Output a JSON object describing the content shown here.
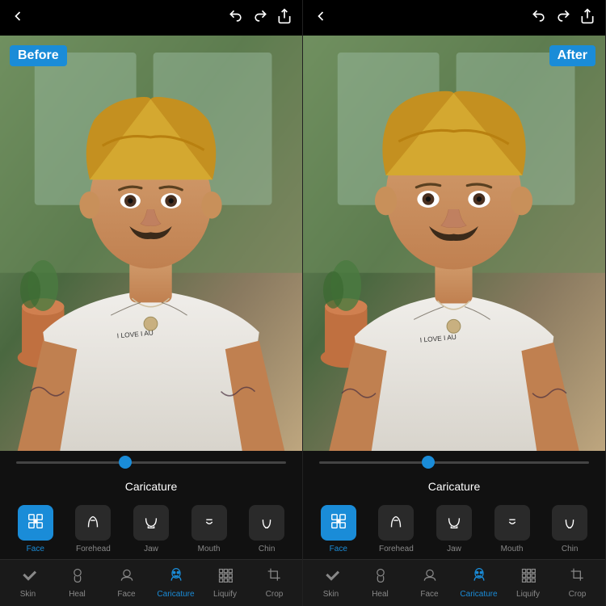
{
  "panels": [
    {
      "id": "before",
      "badge": "Before",
      "badgeType": "before",
      "sliderPosition": "40%",
      "sectionLabel": "Caricature",
      "tools": [
        {
          "id": "face",
          "label": "Face",
          "active": true,
          "icon": "face-grid"
        },
        {
          "id": "forehead",
          "label": "Forehead",
          "active": false,
          "icon": "forehead"
        },
        {
          "id": "jaw",
          "label": "Jaw",
          "active": false,
          "icon": "jaw"
        },
        {
          "id": "mouth",
          "label": "Mouth",
          "active": false,
          "icon": "mouth"
        },
        {
          "id": "chin",
          "label": "Chin",
          "active": false,
          "icon": "chin"
        }
      ],
      "bottomTools": [
        {
          "id": "skin",
          "label": "Skin",
          "active": false,
          "icon": "pencil"
        },
        {
          "id": "heal",
          "label": "Heal",
          "active": false,
          "icon": "person-heal"
        },
        {
          "id": "face-tool",
          "label": "Face",
          "active": false,
          "icon": "face-person"
        },
        {
          "id": "caricature",
          "label": "Caricature",
          "active": true,
          "icon": "caricature-person"
        },
        {
          "id": "liquify",
          "label": "Liquify",
          "active": false,
          "icon": "grid-dots"
        },
        {
          "id": "crop",
          "label": "Crop",
          "active": false,
          "icon": "crop"
        }
      ]
    },
    {
      "id": "after",
      "badge": "After",
      "badgeType": "after",
      "sliderPosition": "40%",
      "sectionLabel": "Caricature",
      "tools": [
        {
          "id": "face",
          "label": "Face",
          "active": true,
          "icon": "face-grid"
        },
        {
          "id": "forehead",
          "label": "Forehead",
          "active": false,
          "icon": "forehead"
        },
        {
          "id": "jaw",
          "label": "Jaw",
          "active": false,
          "icon": "jaw"
        },
        {
          "id": "mouth",
          "label": "Mouth",
          "active": false,
          "icon": "mouth"
        },
        {
          "id": "chin",
          "label": "Chin",
          "active": false,
          "icon": "chin"
        }
      ],
      "bottomTools": [
        {
          "id": "skin",
          "label": "Skin",
          "active": false,
          "icon": "pencil"
        },
        {
          "id": "heal",
          "label": "Heal",
          "active": false,
          "icon": "person-heal"
        },
        {
          "id": "face-tool",
          "label": "Face",
          "active": false,
          "icon": "face-person"
        },
        {
          "id": "caricature",
          "label": "Caricature",
          "active": true,
          "icon": "caricature-person"
        },
        {
          "id": "liquify",
          "label": "Liquify",
          "active": false,
          "icon": "grid-dots"
        },
        {
          "id": "crop",
          "label": "Crop",
          "active": false,
          "icon": "crop"
        }
      ]
    }
  ],
  "colors": {
    "active": "#1a8cd8",
    "inactive_bg": "#2a2a2a",
    "toolbar_bg": "#111",
    "bottom_bg": "#1a1a1a"
  }
}
